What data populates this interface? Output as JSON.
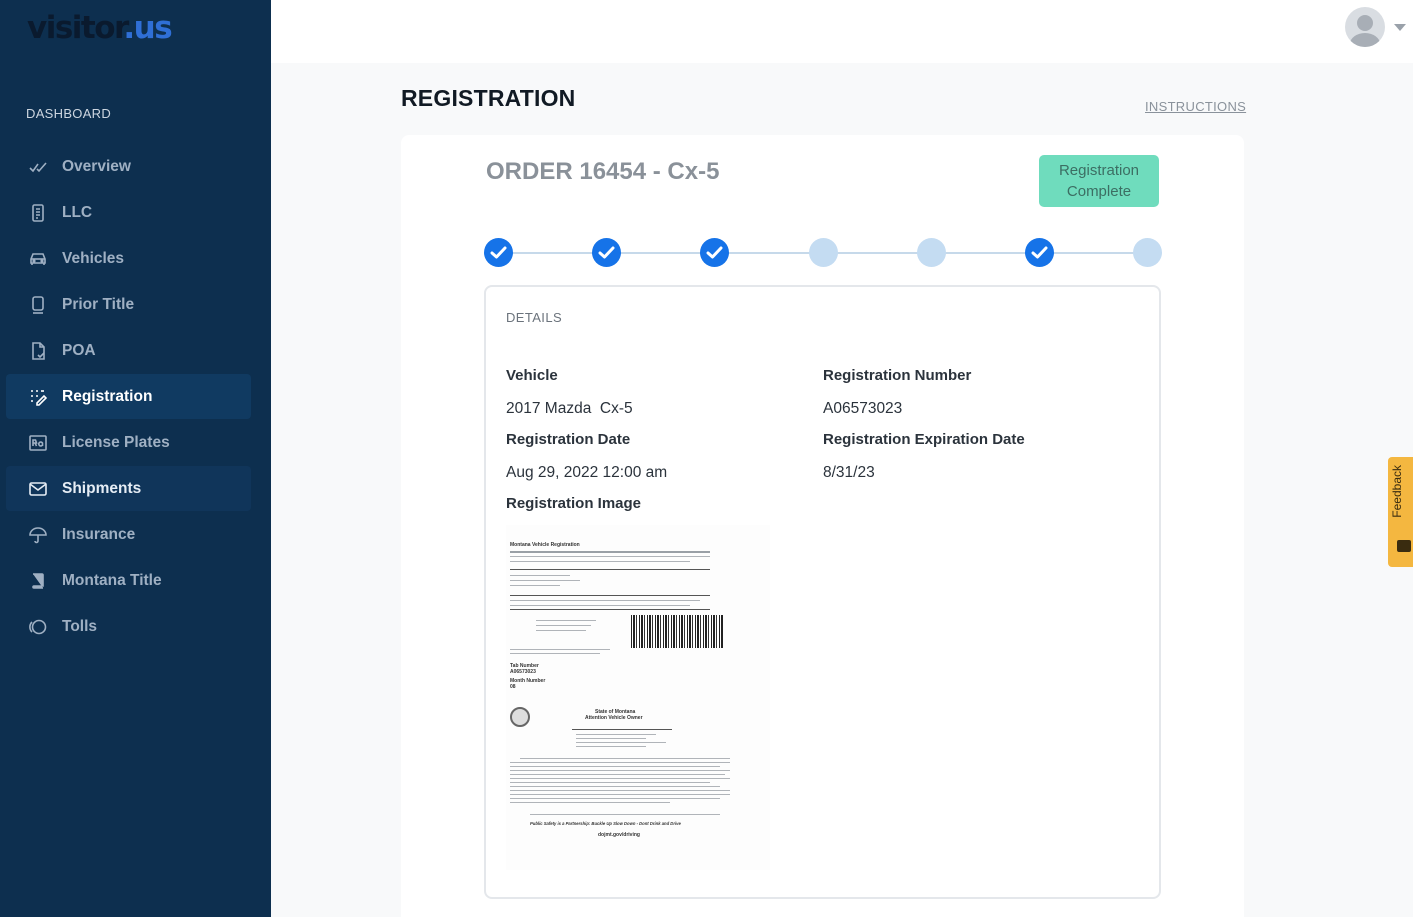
{
  "brand": {
    "part1": "visitor",
    "part2": ".us"
  },
  "sidebar": {
    "section_label": "DASHBOARD",
    "items": [
      {
        "label": "Overview",
        "icon": "check-chart-icon"
      },
      {
        "label": "LLC",
        "icon": "document-icon"
      },
      {
        "label": "Vehicles",
        "icon": "car-icon"
      },
      {
        "label": "Prior Title",
        "icon": "tablet-icon"
      },
      {
        "label": "POA",
        "icon": "file-check-icon"
      },
      {
        "label": "Registration",
        "icon": "grid-edit-icon"
      },
      {
        "label": "License Plates",
        "icon": "plate-icon"
      },
      {
        "label": "Shipments",
        "icon": "mail-icon"
      },
      {
        "label": "Insurance",
        "icon": "umbrella-icon"
      },
      {
        "label": "Montana Title",
        "icon": "book-icon"
      },
      {
        "label": "Tolls",
        "icon": "toll-icon"
      }
    ],
    "active": "Registration"
  },
  "header": {
    "title": "REGISTRATION",
    "instructions_link": "INSTRUCTIONS"
  },
  "order": {
    "title": "ORDER 16454 - Cx-5",
    "status": "Registration Complete",
    "steps": [
      "done",
      "done",
      "done",
      "todo",
      "todo",
      "done",
      "todo"
    ]
  },
  "details": {
    "label": "DETAILS",
    "vehicle_label": "Vehicle",
    "vehicle_value": "2017 Mazda  Cx-5",
    "reg_number_label": "Registration Number",
    "reg_number_value": "A06573023",
    "reg_date_label": "Registration Date",
    "reg_date_value": "Aug 29, 2022 12:00 am",
    "reg_exp_label": "Registration Expiration Date",
    "reg_exp_value": "8/31/23",
    "reg_image_label": "Registration Image"
  },
  "document": {
    "heading": "Montana Vehicle Registration",
    "plate_label": "Tab Number",
    "plate_value": "A06573023",
    "month_label": "Month Number",
    "month_value": "08",
    "notice_title": "State of Montana",
    "notice_subtitle": "Attention Vehicle Owner",
    "footer": "Public Safety is a Partnership: Buckle Up  Slow Down - Dont Drink and Drive",
    "url": "dojmt.gov/driving"
  },
  "feedback": "Feedback",
  "colors": {
    "sidebar": "#0d2f4f",
    "accent": "#1673e8",
    "badge": "#6fdcbd",
    "feedback": "#f4b740"
  }
}
